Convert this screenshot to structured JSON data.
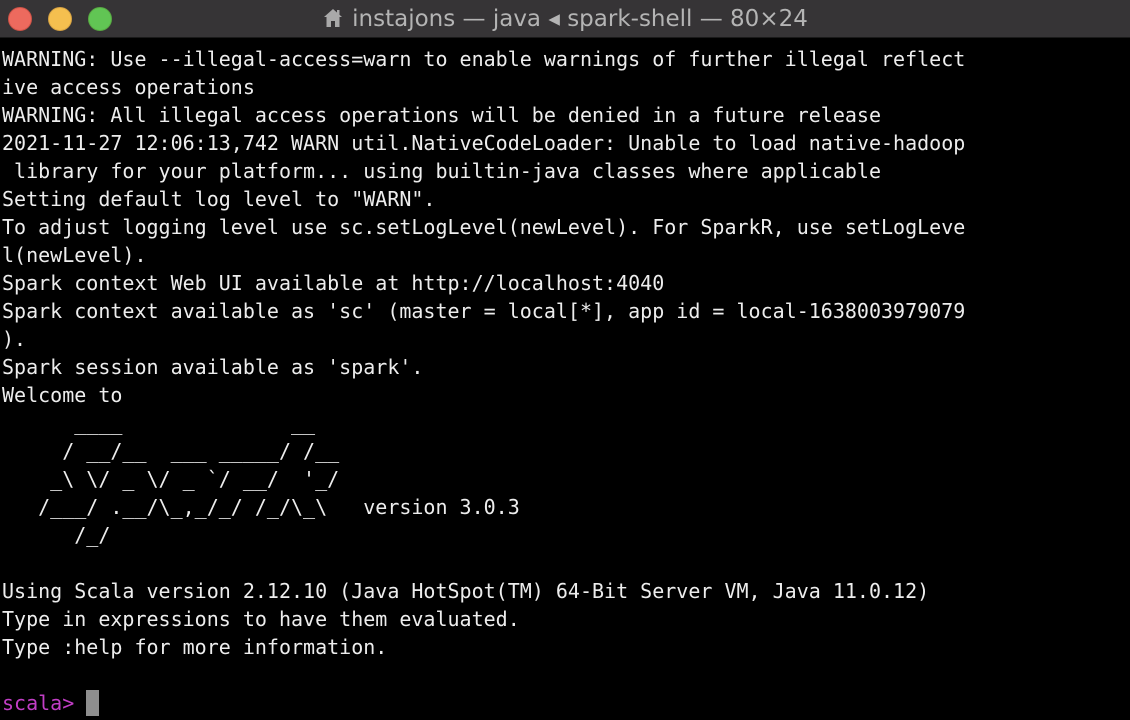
{
  "window": {
    "title": "instajons — java ◂ spark-shell — 80×24",
    "controls": {
      "close_color": "#ed6a5e",
      "minimize_color": "#f5bf4f",
      "zoom_color": "#61c554"
    },
    "title_icon": "home-icon"
  },
  "terminal": {
    "lines": [
      "WARNING: Use --illegal-access=warn to enable warnings of further illegal reflect",
      "ive access operations",
      "WARNING: All illegal access operations will be denied in a future release",
      "2021-11-27 12:06:13,742 WARN util.NativeCodeLoader: Unable to load native-hadoop",
      " library for your platform... using builtin-java classes where applicable",
      "Setting default log level to \"WARN\".",
      "To adjust logging level use sc.setLogLevel(newLevel). For SparkR, use setLogLeve",
      "l(newLevel).",
      "Spark context Web UI available at http://localhost:4040",
      "Spark context available as 'sc' (master = local[*], app id = local-1638003979079",
      ").",
      "Spark session available as 'spark'.",
      "Welcome to",
      "      ____              __",
      "     / __/__  ___ _____/ /__",
      "    _\\ \\/ _ \\/ _ `/ __/  '_/",
      "   /___/ .__/\\_,_/_/ /_/\\_\\   version 3.0.3",
      "      /_/",
      "",
      "Using Scala version 2.12.10 (Java HotSpot(TM) 64-Bit Server VM, Java 11.0.12)",
      "Type in expressions to have them evaluated.",
      "Type :help for more information.",
      ""
    ],
    "prompt": "scala>",
    "prompt_color": "#c23ec6",
    "text_color": "#ededed"
  }
}
